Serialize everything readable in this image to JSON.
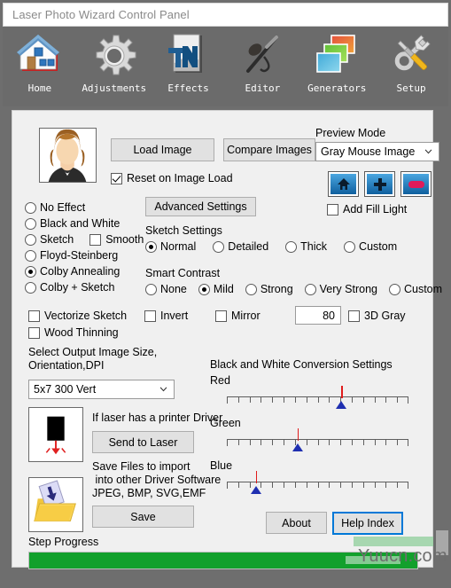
{
  "window": {
    "title": "Laser Photo Wizard Control Panel"
  },
  "toolbar": {
    "items": [
      {
        "label": "Home",
        "icon": "house-icon"
      },
      {
        "label": "Adjustments",
        "icon": "gear-icon"
      },
      {
        "label": "Effects",
        "icon": "text-effects-icon"
      },
      {
        "label": "Editor",
        "icon": "pen-icon"
      },
      {
        "label": "Generators",
        "icon": "layers-icon"
      },
      {
        "label": "Setup",
        "icon": "tools-icon"
      }
    ]
  },
  "main": {
    "load_image_label": "Load Image",
    "compare_images_label": "Compare Images",
    "reset_on_image_load": {
      "label": "Reset on Image Load",
      "checked": true
    },
    "preview_mode": {
      "label": "Preview Mode",
      "value": "Gray Mouse Image",
      "options": [
        "Gray Mouse Image"
      ]
    },
    "icon_buttons": [
      {
        "name": "home-preview-button",
        "icon": "home-icon"
      },
      {
        "name": "zoom-in-button",
        "icon": "plus-icon"
      },
      {
        "name": "zoom-out-button",
        "icon": "minus-icon"
      }
    ],
    "add_fill_light": {
      "label": "Add Fill Light",
      "checked": false
    },
    "advanced_settings_label": "Advanced Settings",
    "effect_options": [
      {
        "label": "No Effect",
        "selected": false
      },
      {
        "label": "Black and White",
        "selected": false
      },
      {
        "label": "Sketch",
        "selected": false
      },
      {
        "label": "Floyd-Steinberg",
        "selected": false
      },
      {
        "label": "Colby Annealing",
        "selected": true
      },
      {
        "label": "Colby + Sketch",
        "selected": false
      }
    ],
    "smooth_checkbox": {
      "label": "Smooth",
      "checked": false
    },
    "sketch_settings": {
      "label": "Sketch Settings",
      "options": [
        {
          "label": "Normal",
          "selected": true
        },
        {
          "label": "Detailed",
          "selected": false
        },
        {
          "label": "Thick",
          "selected": false
        },
        {
          "label": "Custom",
          "selected": false
        }
      ]
    },
    "smart_contrast": {
      "label": "Smart Contrast",
      "options": [
        {
          "label": "None",
          "selected": false
        },
        {
          "label": "Mild",
          "selected": true
        },
        {
          "label": "Strong",
          "selected": false
        },
        {
          "label": "Very Strong",
          "selected": false
        },
        {
          "label": "Custom",
          "selected": false
        }
      ]
    },
    "checkboxes_row": [
      {
        "label": "Vectorize Sketch",
        "checked": false
      },
      {
        "label": "Invert",
        "checked": false
      },
      {
        "label": "Mirror",
        "checked": false
      },
      {
        "label": "3D Gray",
        "checked": false
      },
      {
        "label": "Wood Thinning",
        "checked": false
      }
    ],
    "threshold_value": "80",
    "output_size_label_line1": "Select Output Image Size,",
    "output_size_label_line2": "Orientation,DPI",
    "output_size": {
      "value": "5x7 300 Vert",
      "options": [
        "5x7 300 Vert"
      ]
    },
    "printer_driver_note": "If laser has a printer Driver",
    "send_to_laser_label": "Send to Laser",
    "save_note_line1": "Save Files to import",
    "save_note_line2": " into other Driver Software",
    "save_note_line3": "JPEG, BMP, SVG,EMF",
    "save_label": "Save",
    "step_progress_label": "Step Progress",
    "progress_percent": 100,
    "about_label": "About",
    "help_index_label": "Help Index",
    "bw_settings": {
      "title": "Black and White Conversion Settings",
      "sliders": [
        {
          "label": "Red",
          "position_percent": 63
        },
        {
          "label": "Green",
          "position_percent": 39
        },
        {
          "label": "Blue",
          "position_percent": 16
        }
      ]
    }
  },
  "watermark": {
    "text": "Yuucn.com"
  },
  "colors": {
    "toolbar_bg": "#6b6b6b",
    "panel_bg": "#f0f0f0",
    "progress_green": "#12a02c",
    "focus_blue": "#0078d7",
    "slider_needle_red": "#e01b1b",
    "slider_thumb_blue": "#1f2fb0"
  }
}
